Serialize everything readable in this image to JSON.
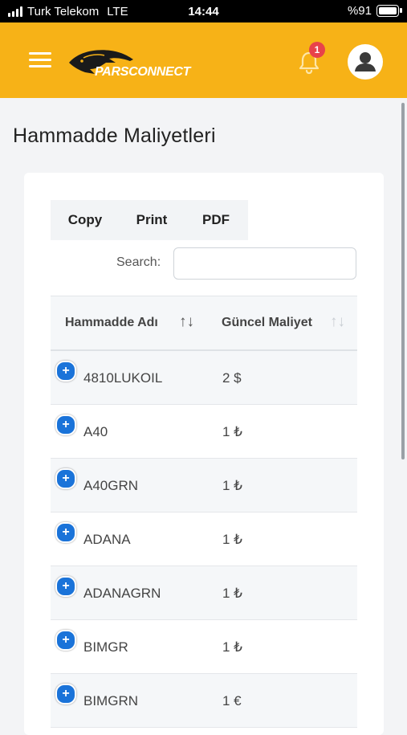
{
  "status_bar": {
    "carrier": "Turk Telekom",
    "network": "LTE",
    "time": "14:44",
    "battery_text": "%91",
    "battery_level_percent": 91
  },
  "header": {
    "brand_name": "PARSCONNECT",
    "notification_count": "1",
    "accent_color": "#f7b217",
    "badge_color": "#e8424a"
  },
  "page": {
    "title": "Hammadde Maliyetleri"
  },
  "toolbar": {
    "copy_label": "Copy",
    "print_label": "Print",
    "pdf_label": "PDF"
  },
  "search": {
    "label": "Search:",
    "value": "",
    "placeholder": ""
  },
  "table": {
    "columns": [
      "Hammadde Adı",
      "Güncel Maliyet"
    ],
    "rows": [
      {
        "name": "4810LUKOIL",
        "cost": "2 $"
      },
      {
        "name": "A40",
        "cost": "1 ₺"
      },
      {
        "name": "A40GRN",
        "cost": "1 ₺"
      },
      {
        "name": "ADANA",
        "cost": "1 ₺"
      },
      {
        "name": "ADANAGRN",
        "cost": "1 ₺"
      },
      {
        "name": "BIMGR",
        "cost": "1 ₺"
      },
      {
        "name": "BIMGRN",
        "cost": "1 €"
      }
    ]
  },
  "icons": {
    "menu": "hamburger-menu-icon",
    "notifications": "bell-icon",
    "profile": "user-avatar-icon",
    "sort": "sort-arrows-icon",
    "expand_row": "plus-circle-icon"
  }
}
